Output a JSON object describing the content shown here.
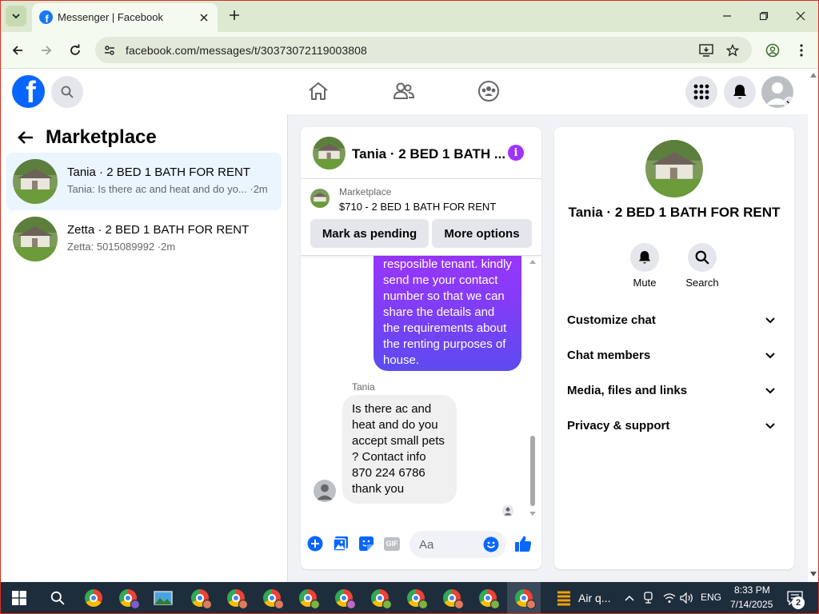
{
  "browser": {
    "tab_title": "Messenger | Facebook",
    "url": "facebook.com/messages/t/30373072119003808"
  },
  "facebook": {
    "logo_letter": "f"
  },
  "left": {
    "title": "Marketplace",
    "conversations": [
      {
        "name": "Tania · 2 BED 1 BATH FOR RENT",
        "preview": "Tania: Is there ac and heat and do yo... ·2m"
      },
      {
        "name": "Zetta · 2 BED 1 BATH FOR RENT",
        "preview": "Zetta: 5015089992 ·2m"
      }
    ]
  },
  "chat": {
    "header_name": "Tania · 2 BED 1 BATH ...",
    "info_glyph": "i",
    "marketplace_label": "Marketplace",
    "listing": "$710 - 2 BED 1 BATH FOR RENT",
    "mark_pending": "Mark as pending",
    "more_options": "More options",
    "outgoing_message": "resposible tenant. kindly send me your contact number so that we can share the details and the requirements about the renting purposes of house.",
    "sender_name": "Tania",
    "incoming_message": "Is there ac and heat and do you accept small pets ? Contact info 870 224 6786 thank you",
    "composer_placeholder": "Aa",
    "gif_label": "GIF"
  },
  "info": {
    "name": "Tania · 2 BED 1 BATH FOR RENT",
    "mute_label": "Mute",
    "search_label": "Search",
    "sections": [
      "Customize chat",
      "Chat members",
      "Media, files and links",
      "Privacy & support"
    ]
  },
  "taskbar": {
    "air_label": "Air q...",
    "lang": "ENG",
    "time": "8:33 PM",
    "date": "7/14/2025",
    "notif_count": "2"
  },
  "colors": {
    "facebook_blue": "#0866ff",
    "messenger_purple": "#a033ff",
    "browser_frame": "#dde9d1",
    "taskbar": "#1e2d3c"
  }
}
